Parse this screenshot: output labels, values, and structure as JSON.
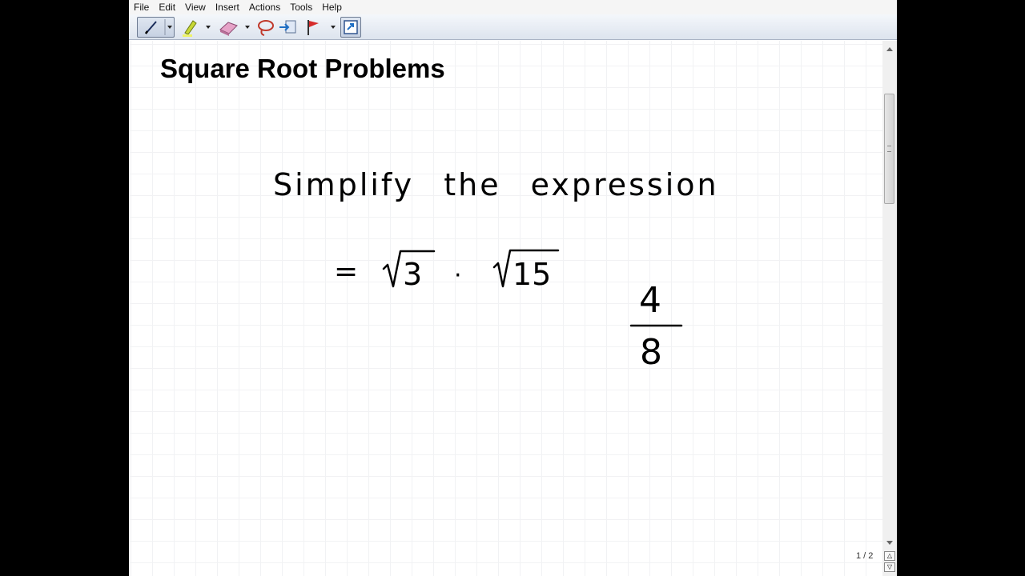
{
  "menu": [
    "File",
    "Edit",
    "View",
    "Insert",
    "Actions",
    "Tools",
    "Help"
  ],
  "toolbar": {
    "tools": [
      "pen-icon",
      "highlighter-icon",
      "eraser-icon",
      "lasso-icon",
      "insert-space-icon",
      "flag-icon",
      "full-page-icon"
    ]
  },
  "page": {
    "title": "Square Root Problems",
    "instruction": "Simplify the expression",
    "expression": {
      "equals": "=",
      "radicand1": "3",
      "dot": "·",
      "radicand2": "15"
    },
    "fraction": {
      "numerator": "4",
      "denominator": "8"
    }
  },
  "footer": {
    "page_indicator": "1 / 2"
  }
}
